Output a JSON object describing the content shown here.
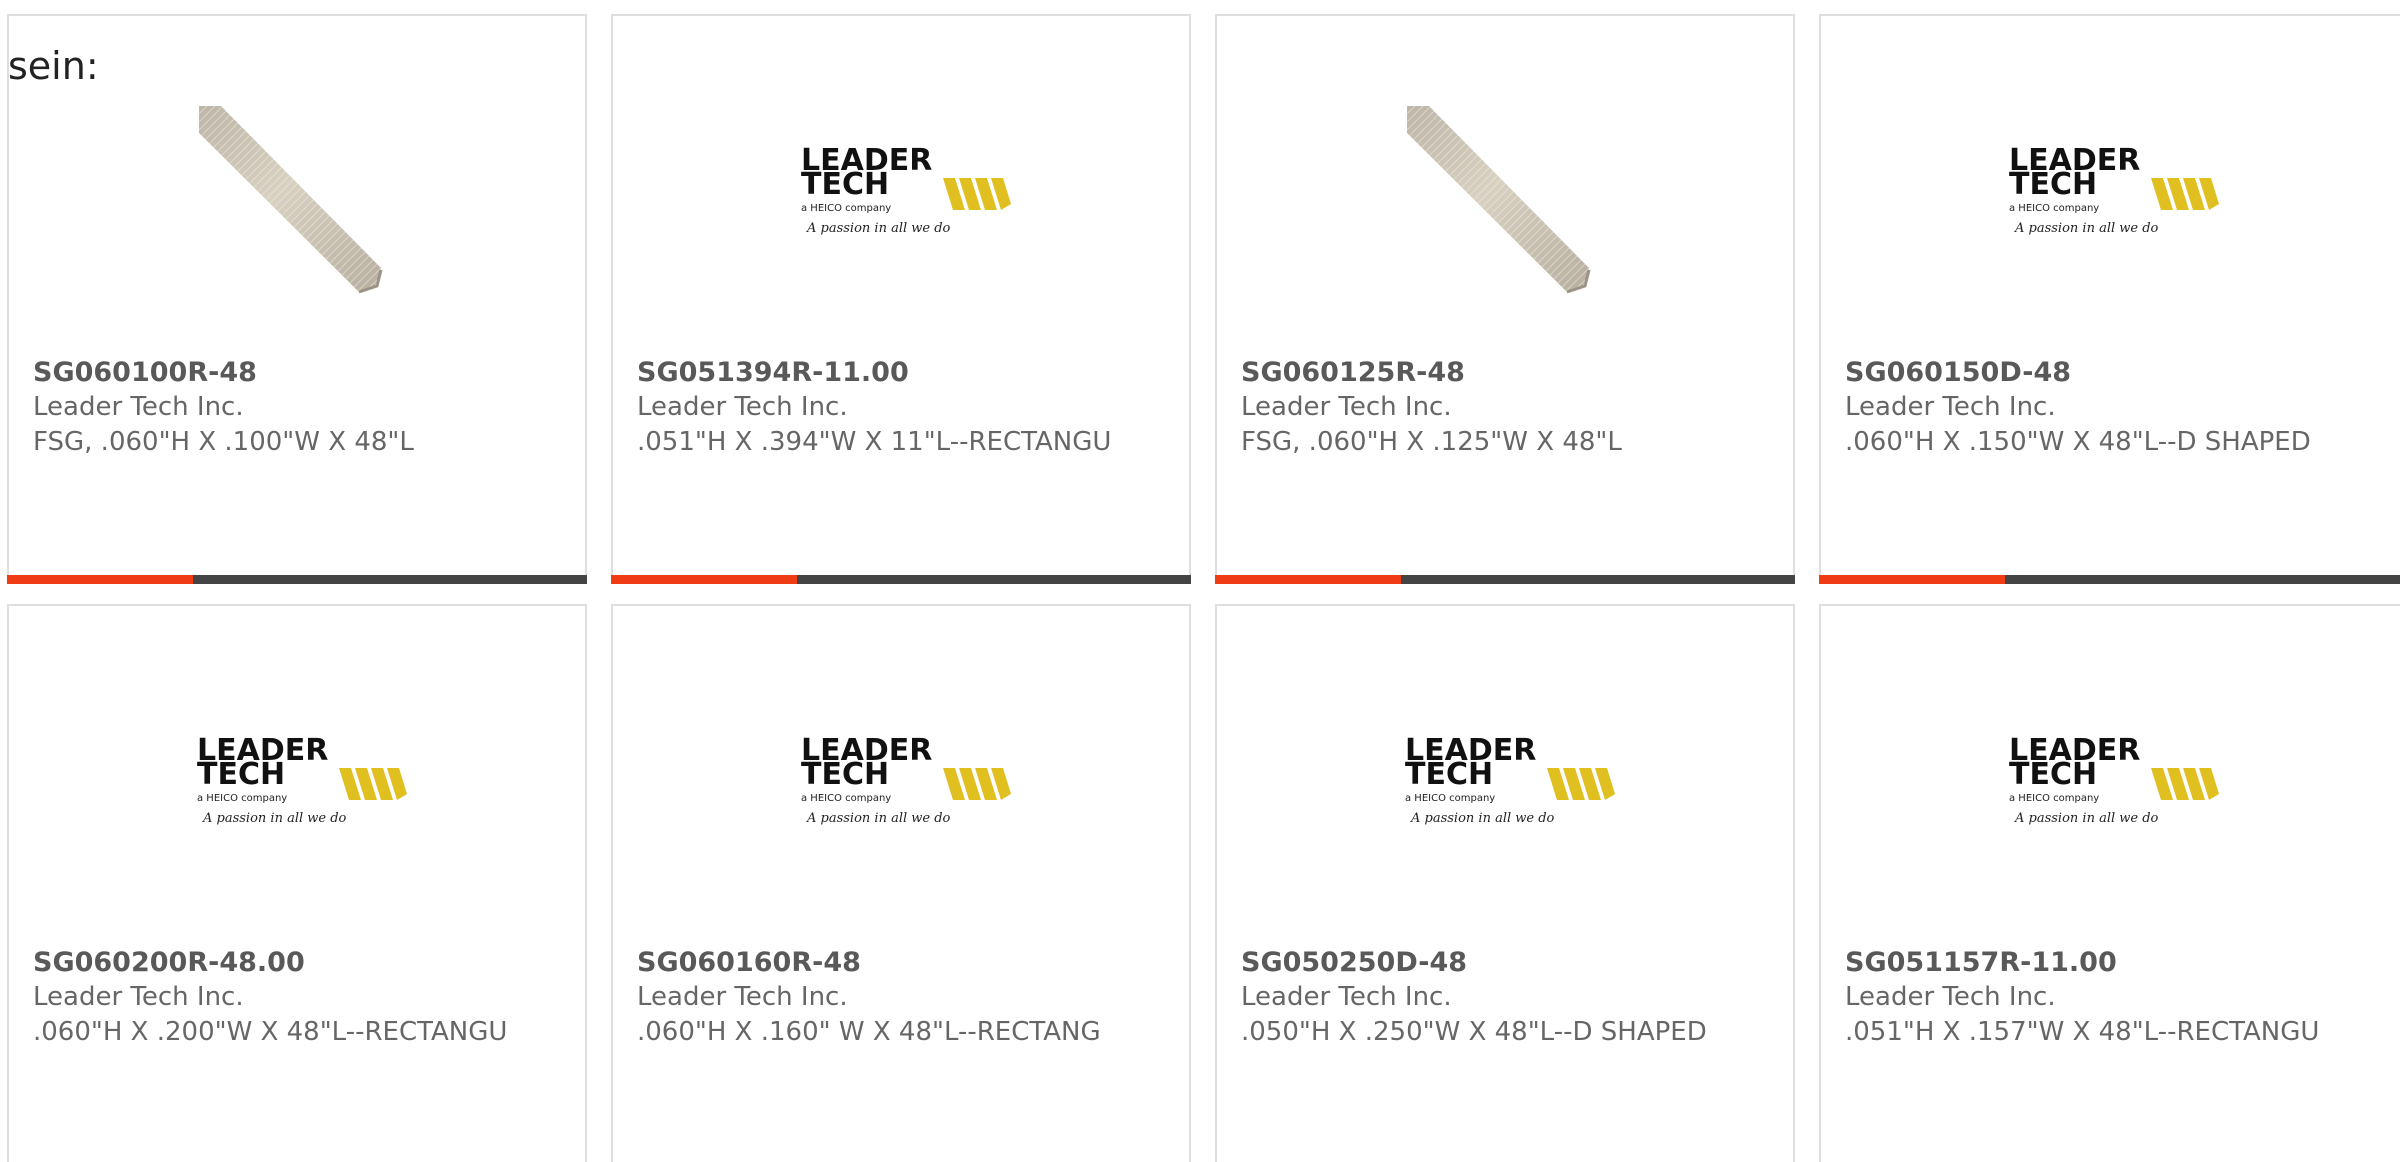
{
  "top_label": "sein:",
  "colors": {
    "card_border": "#dedede",
    "bar_dark": "#444444",
    "bar_accent": "#ef3c15",
    "text_muted": "#666666",
    "logo_yellow": "#e0bf20"
  },
  "products": [
    {
      "sku": "SG060100R-48",
      "manufacturer": "Leader Tech Inc.",
      "description": "FSG, .060\"H X .100\"W X 48\"L",
      "image": "metal-strip-image"
    },
    {
      "sku": "SG051394R-11.00",
      "manufacturer": "Leader Tech Inc.",
      "description": ".051\"H X .394\"W X 11\"L--RECTANGU",
      "image": "leader-tech-logo"
    },
    {
      "sku": "SG060125R-48",
      "manufacturer": "Leader Tech Inc.",
      "description": "FSG, .060\"H X .125\"W X 48\"L",
      "image": "metal-strip-image"
    },
    {
      "sku": "SG060150D-48",
      "manufacturer": "Leader Tech Inc.",
      "description": ".060\"H X .150\"W X 48\"L--D SHAPED",
      "image": "leader-tech-logo"
    },
    {
      "sku": "SG060200R-48.00",
      "manufacturer": "Leader Tech Inc.",
      "description": ".060\"H X .200\"W X 48\"L--RECTANGU",
      "image": "leader-tech-logo"
    },
    {
      "sku": "SG060160R-48",
      "manufacturer": "Leader Tech Inc.",
      "description": ".060\"H X .160\" W X 48\"L--RECTANG",
      "image": "leader-tech-logo"
    },
    {
      "sku": "SG050250D-48",
      "manufacturer": "Leader Tech Inc.",
      "description": ".050\"H X .250\"W X 48\"L--D SHAPED",
      "image": "leader-tech-logo"
    },
    {
      "sku": "SG051157R-11.00",
      "manufacturer": "Leader Tech Inc.",
      "description": ".051\"H X .157\"W X 48\"L--RECTANGU",
      "image": "leader-tech-logo"
    }
  ],
  "logo": {
    "line1": "LEADER",
    "line2": "TECH",
    "subtitle": "a HEICO company",
    "tagline": "A passion in all we do"
  }
}
